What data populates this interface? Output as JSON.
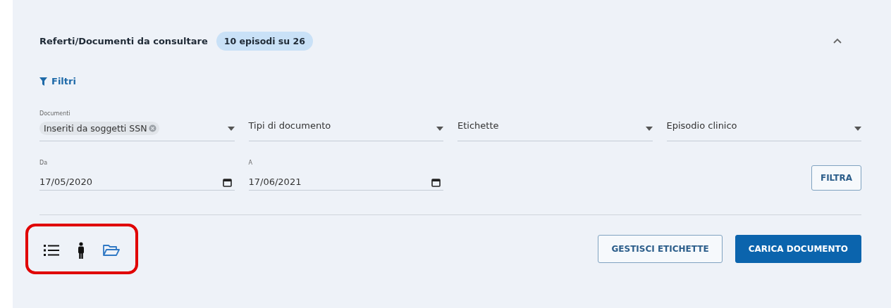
{
  "header": {
    "title": "Referti/Documenti da consultare",
    "badge": "10 episodi su 26",
    "expanded": true
  },
  "filters_toggle": {
    "label": "Filtri"
  },
  "selects": [
    {
      "label": "Documenti",
      "chip": "Inseriti da soggetti SSN"
    },
    {
      "placeholder": "Tipi di documento"
    },
    {
      "placeholder": "Etichette"
    },
    {
      "placeholder": "Episodio clinico"
    }
  ],
  "dates": [
    {
      "label": "Da",
      "value": "17/05/2020"
    },
    {
      "label": "A",
      "value": "17/06/2021"
    }
  ],
  "filter_button": "FILTRA",
  "views": {
    "highlighted": true,
    "items": [
      {
        "kind": "list",
        "selected": false
      },
      {
        "kind": "person",
        "selected": false
      },
      {
        "kind": "folder",
        "selected": true
      }
    ]
  },
  "actions": [
    {
      "label": "GESTISCI ETICHETTE",
      "kind": "outline"
    },
    {
      "label": "CARICA DOCUMENTO",
      "kind": "primary"
    }
  ]
}
